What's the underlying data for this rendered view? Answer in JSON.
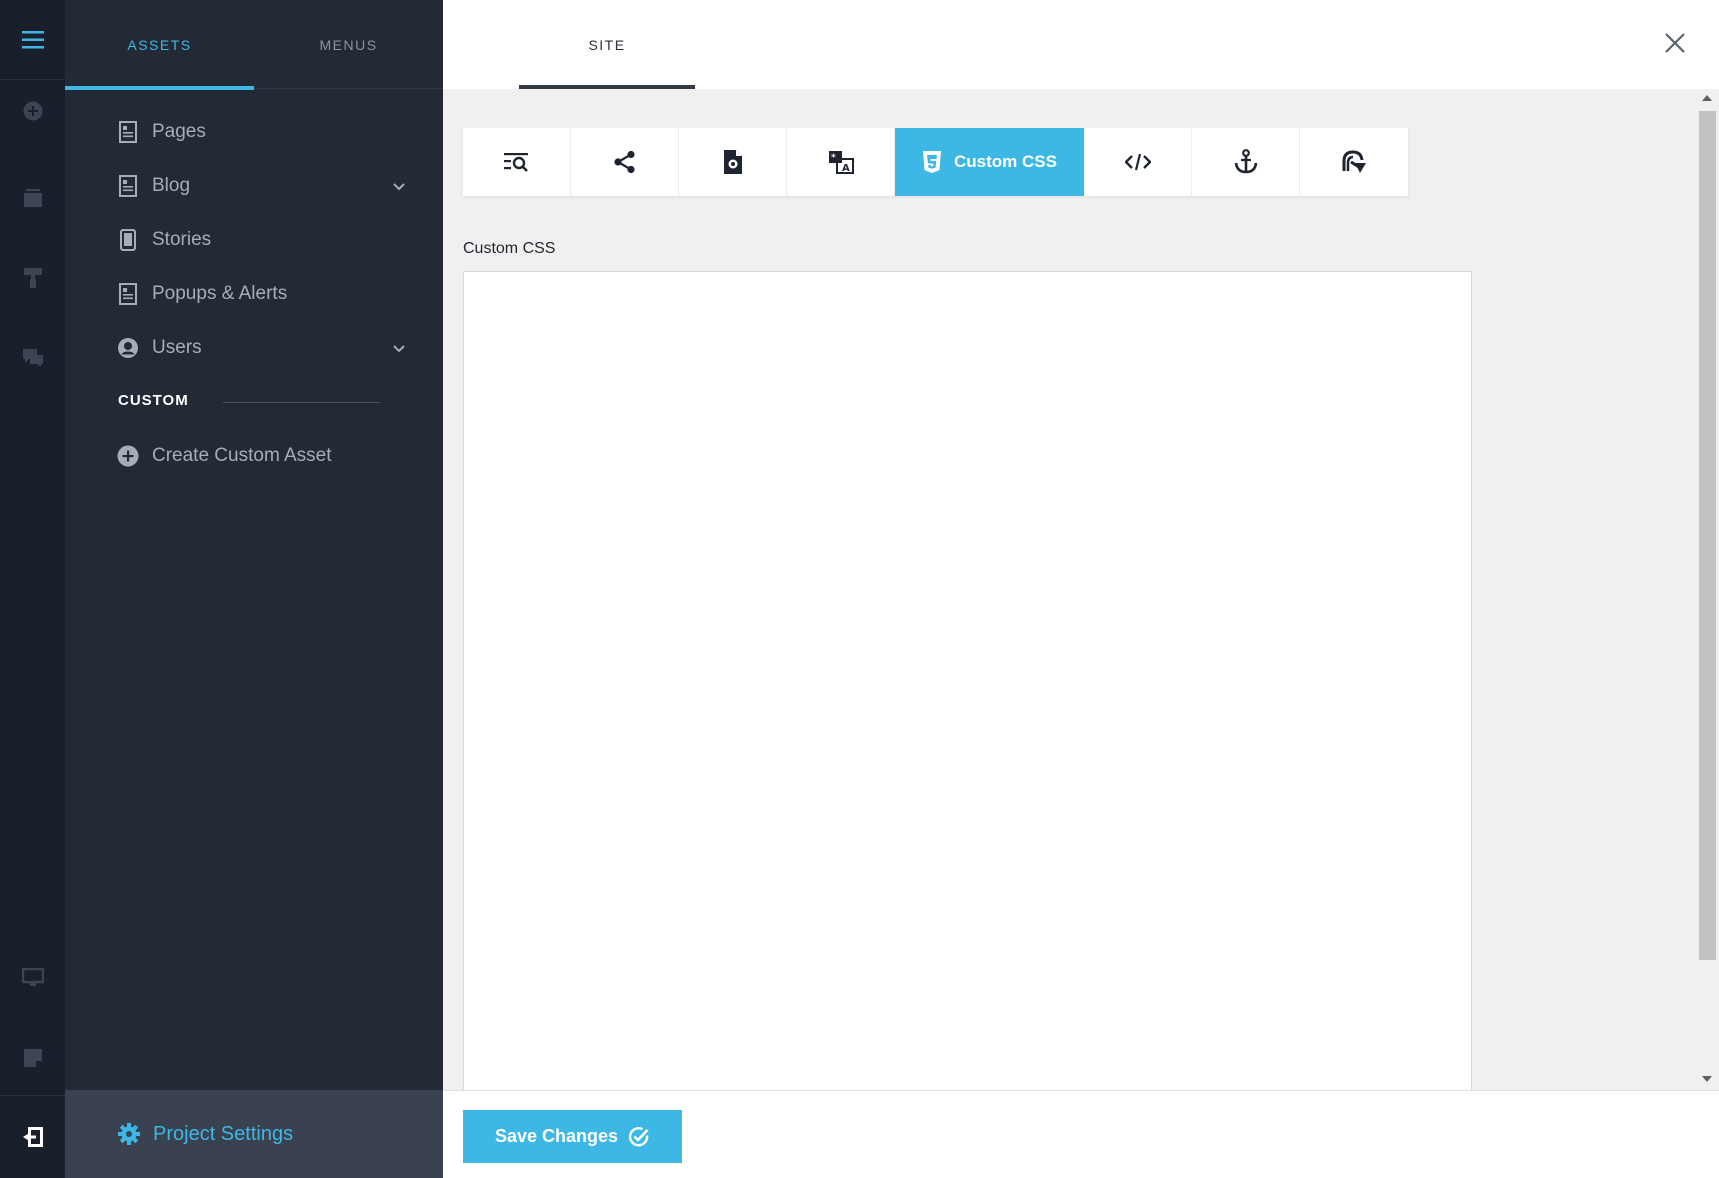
{
  "colors": {
    "accent": "#3db8e5",
    "rail_bg": "#1a202b",
    "panel_bg": "#232a36",
    "footer_bg": "#3a4150"
  },
  "rail": {
    "icons": [
      "menu-icon",
      "add-circle-icon",
      "layers-icon",
      "paint-roller-icon",
      "comments-icon",
      "desktop-icon",
      "note-icon",
      "exit-icon"
    ]
  },
  "panel": {
    "tabs": [
      {
        "label": "ASSETS",
        "active": true
      },
      {
        "label": "MENUS",
        "active": false
      }
    ],
    "items": [
      {
        "label": "Pages",
        "icon": "page-icon",
        "expandable": false
      },
      {
        "label": "Blog",
        "icon": "page-icon",
        "expandable": true
      },
      {
        "label": "Stories",
        "icon": "mobile-icon",
        "expandable": false
      },
      {
        "label": "Popups & Alerts",
        "icon": "page-icon",
        "expandable": false
      },
      {
        "label": "Users",
        "icon": "user-circle-icon",
        "expandable": true
      }
    ],
    "section_label": "CUSTOM",
    "create_label": "Create Custom Asset",
    "footer_label": "Project Settings"
  },
  "main": {
    "top_tab": "SITE",
    "toolbar": {
      "active_label": "Custom CSS",
      "icons": [
        "seo-search-icon",
        "share-icon",
        "file-settings-icon",
        "translate-icon",
        "css3-icon",
        "code-icon",
        "anchor-icon",
        "redirect-icon"
      ]
    },
    "field_label": "Custom CSS",
    "css_value": "",
    "save_label": "Save Changes"
  }
}
